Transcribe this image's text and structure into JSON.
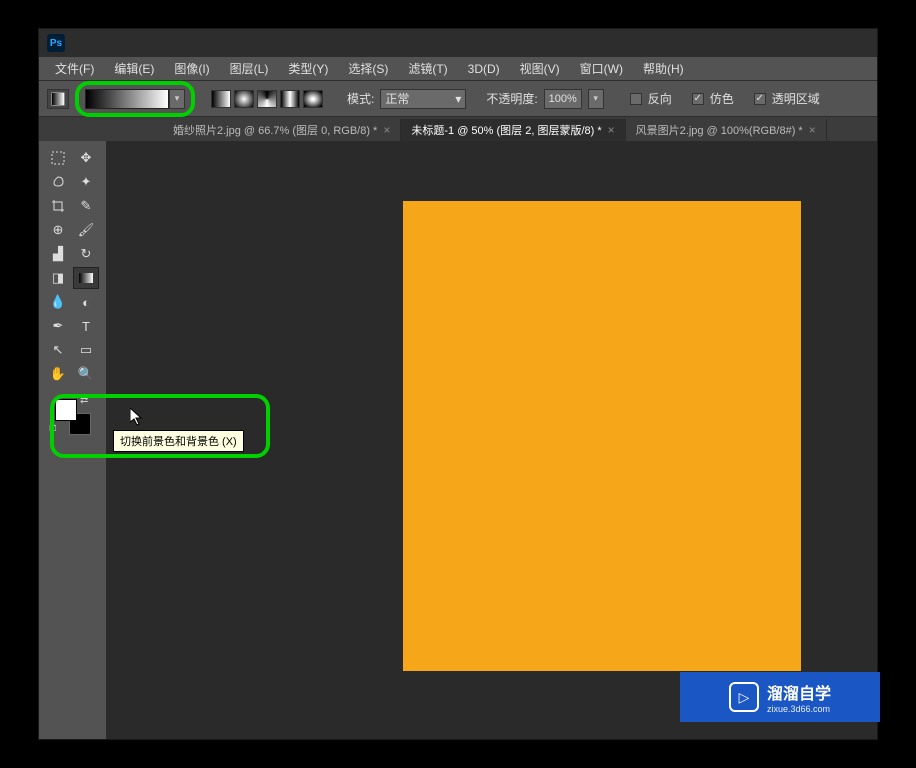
{
  "menu": {
    "file": "文件(F)",
    "edit": "编辑(E)",
    "image": "图像(I)",
    "layer": "图层(L)",
    "type": "类型(Y)",
    "select": "选择(S)",
    "filter": "滤镜(T)",
    "3d": "3D(D)",
    "view": "视图(V)",
    "window": "窗口(W)",
    "help": "帮助(H)"
  },
  "options": {
    "mode_label": "模式:",
    "mode_value": "正常",
    "opacity_label": "不透明度:",
    "opacity_value": "100%",
    "check_reverse": "反向",
    "check_dither": "仿色",
    "check_transparent": "透明区域"
  },
  "tabs": [
    {
      "label": "婚纱照片2.jpg @ 66.7% (图层 0, RGB/8) *",
      "active": false
    },
    {
      "label": "未标题-1 @ 50% (图层 2, 图层蒙版/8) *",
      "active": true
    },
    {
      "label": "风景图片2.jpg @ 100%(RGB/8#) *",
      "active": false
    }
  ],
  "tooltip": {
    "swap_colors": "切换前景色和背景色 (X)"
  },
  "watermark": {
    "title": "溜溜自学",
    "sub": "zixue.3d66.com"
  },
  "colors": {
    "canvas_fill": "#f5a719",
    "fg": "#ffffff",
    "bg": "#000000"
  }
}
